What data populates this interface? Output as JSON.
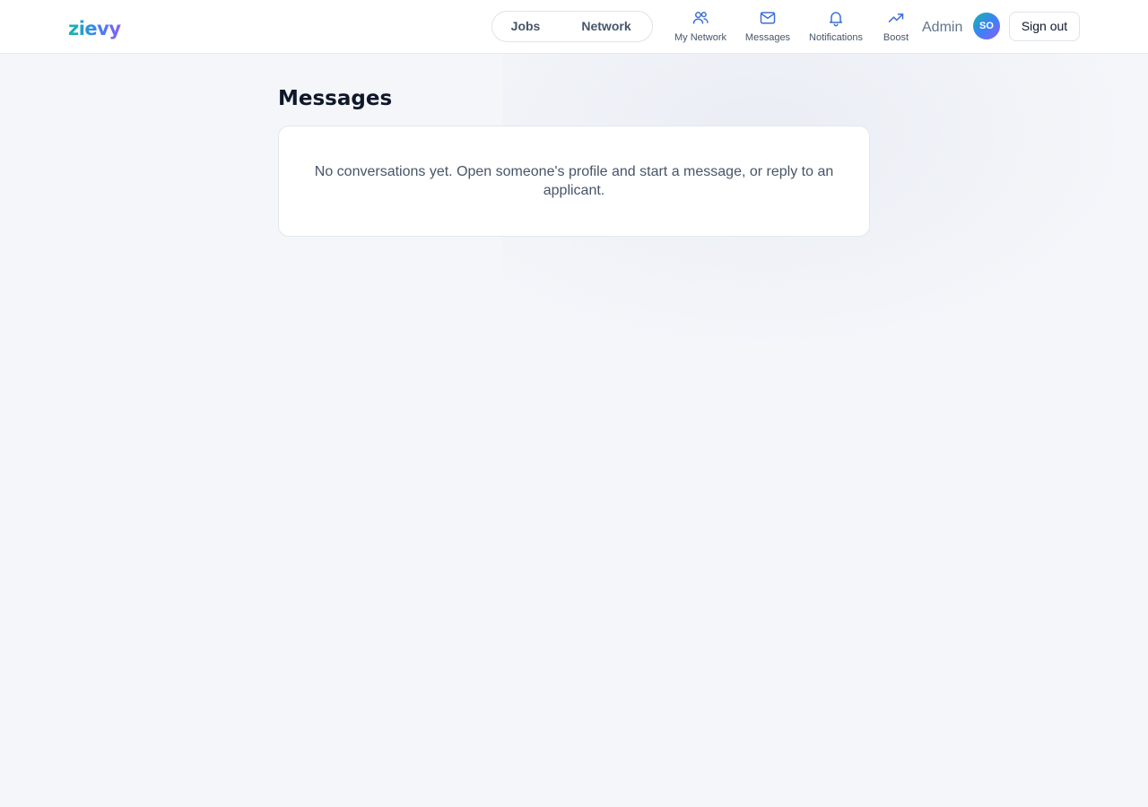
{
  "header": {
    "logo": "zievy",
    "toggle": {
      "jobs_label": "Jobs",
      "network_label": "Network"
    },
    "nav": {
      "my_network": {
        "label": "My Network",
        "icon": "users-icon"
      },
      "messages": {
        "label": "Messages",
        "icon": "mail-icon"
      },
      "notifications": {
        "label": "Notifications",
        "icon": "bell-icon"
      },
      "boost": {
        "label": "Boost",
        "icon": "trending-up-icon"
      }
    },
    "admin_label": "Admin",
    "avatar_initials": "SO",
    "signout_label": "Sign out"
  },
  "main": {
    "title": "Messages",
    "empty_message": "No conversations yet. Open someone's profile and start a message, or reply to an applicant."
  },
  "colors": {
    "accent": "#3b82f6",
    "brand_gradient_start": "#14b8a6",
    "brand_gradient_end": "#8b5cf6",
    "background": "#f4f6fa"
  }
}
